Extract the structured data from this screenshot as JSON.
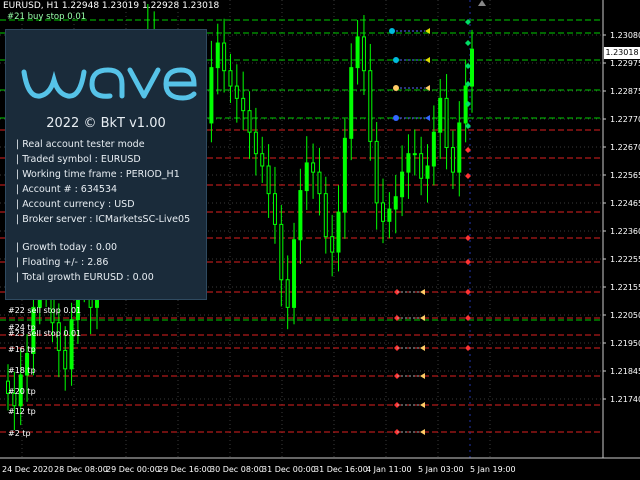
{
  "header": {
    "symbol_line": "EURUSD, H1  1.22948 1.23019 1.22928 1.23018",
    "first_order": "#21 buy stop 0.01"
  },
  "panel": {
    "logo_text": "wave",
    "copyright": "2022 © BkT v1.00",
    "lines1": [
      "| Real account tester mode",
      "| Traded symbol : EURUSD",
      "| Working time frame : PERIOD_H1",
      "| Account # : 634534",
      "| Account currency : USD",
      "| Broker server : ICMarketsSC-Live05"
    ],
    "lines2": [
      "| Growth today : 0.00",
      "| Floating +/- : 2.86",
      "| Total growth EURUSD : 0.00"
    ]
  },
  "current_price": "1.23018",
  "price_axis": [
    "1.23080",
    "1.22975",
    "1.22875",
    "1.22770",
    "1.22670",
    "1.22565",
    "1.22465",
    "1.22360",
    "1.22255",
    "1.22155",
    "1.22050",
    "1.21950",
    "1.21845",
    "1.21740"
  ],
  "time_axis": [
    "24 Dec 2020",
    "28 Dec 08:00",
    "29 Dec 00:00",
    "29 Dec 16:00",
    "30 Dec 08:00",
    "31 Dec 00:00",
    "31 Dec 16:00",
    "4 Jan 11:00",
    "5 Jan 03:00",
    "5 Jan 19:00"
  ],
  "order_labels": [
    "#22 sell stop 0.01",
    "#24 tp",
    "#23 sell stop 0.01",
    "#16 tp",
    "#18 tp",
    "#20 tp",
    "#12 tp",
    "#2 tp"
  ],
  "colors": {
    "background": "#000000",
    "candle": "#00ff00",
    "grid": "#3a3a3a",
    "buy_line": "#00cc00",
    "sell_line": "#dd2020",
    "panel_bg": "#1a2b3a",
    "logo": "#56c3e8"
  },
  "chart_data": {
    "type": "candlestick",
    "symbol": "EURUSD",
    "timeframe": "H1",
    "ohlc_last": [
      1.22948,
      1.23019,
      1.22928,
      1.23018
    ],
    "ylim": [
      1.2169,
      1.2318
    ],
    "close": [
      1.219,
      1.2186,
      1.2196,
      1.2203,
      1.2218,
      1.2232,
      1.2226,
      1.2213,
      1.2204,
      1.2198,
      1.2214,
      1.2226,
      1.2233,
      1.2218,
      1.2232,
      1.2255,
      1.2258,
      1.2271,
      1.2266,
      1.2285,
      1.2294,
      1.23,
      1.2308,
      1.2298,
      1.2286,
      1.2283,
      1.2276,
      1.2273,
      1.2288,
      1.2286,
      1.2272,
      1.2278,
      1.2296,
      1.2304,
      1.2295,
      1.229,
      1.2286,
      1.2282,
      1.2275,
      1.2268,
      1.2264,
      1.2255,
      1.2245,
      1.2227,
      1.2218,
      1.224,
      1.2256,
      1.2265,
      1.2262,
      1.2255,
      1.2241,
      1.2236,
      1.2249,
      1.2273,
      1.2296,
      1.2306,
      1.2295,
      1.2272,
      1.2252,
      1.2246,
      1.225,
      1.2254,
      1.2262,
      1.2268,
      1.2268,
      1.226,
      1.2264,
      1.2275,
      1.2286,
      1.227,
      1.2262,
      1.2278,
      1.229,
      1.2302
    ]
  }
}
